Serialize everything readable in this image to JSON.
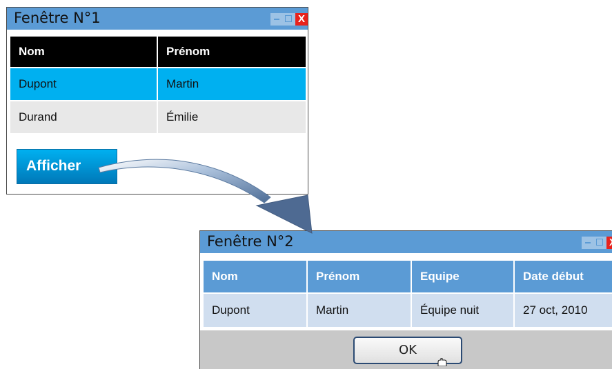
{
  "window1": {
    "title": "Fenêtre N°1",
    "close_glyph": "X",
    "columns": [
      "Nom",
      "Prénom"
    ],
    "rows": [
      {
        "nom": "Dupont",
        "prenom": "Martin",
        "selected": true
      },
      {
        "nom": "Durand",
        "prenom": "Émilie",
        "selected": false
      }
    ],
    "button_label": "Afficher"
  },
  "window2": {
    "title": "Fenêtre N°2",
    "close_glyph": "X",
    "columns": [
      "Nom",
      "Prénom",
      "Equipe",
      "Date début"
    ],
    "rows": [
      {
        "nom": "Dupont",
        "prenom": "Martin",
        "equipe": "Équipe nuit",
        "date": "27 oct, 2010"
      }
    ],
    "ok_label": "OK"
  },
  "colors": {
    "titlebar": "#5b9bd5",
    "selected_row": "#00b0f0",
    "header_w1": "#000000",
    "close": "#e8221c",
    "arrow": "#5b7aa0"
  },
  "icons": [
    "minimize-icon",
    "maximize-icon",
    "close-icon",
    "flow-arrow-icon",
    "mouse-cursor-icon"
  ]
}
